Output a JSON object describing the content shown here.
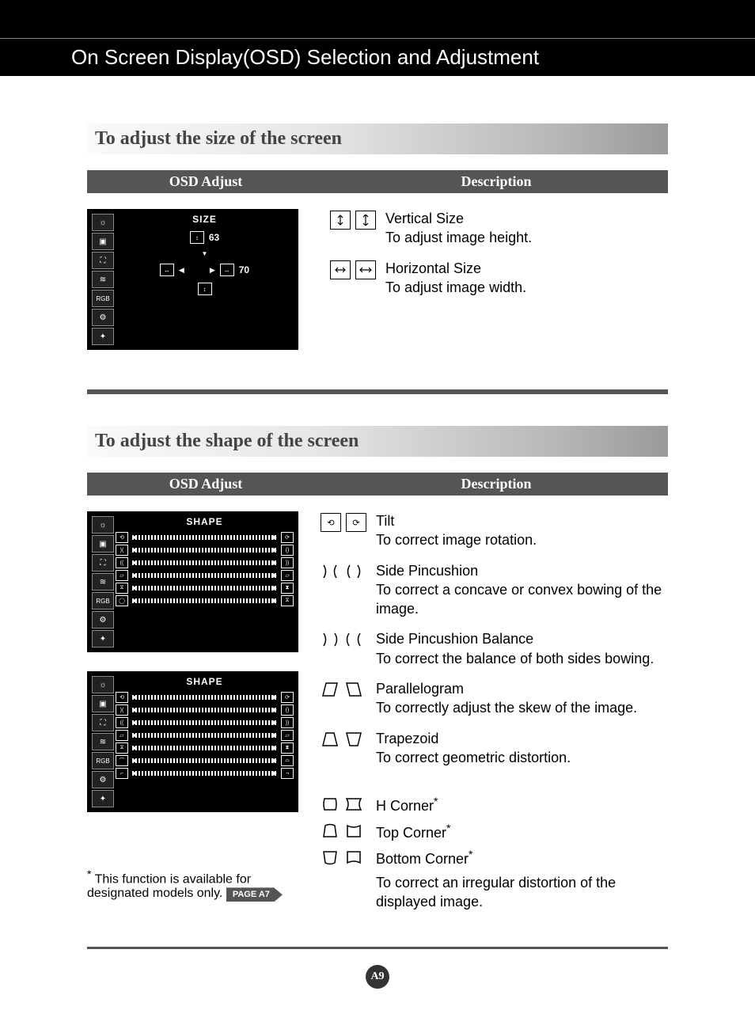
{
  "header": {
    "title": "On Screen Display(OSD) Selection and Adjustment"
  },
  "section_size": {
    "heading": "To adjust the size of the screen",
    "col_left": "OSD Adjust",
    "col_right": "Description",
    "osd": {
      "title": "SIZE",
      "v_value": "63",
      "h_value": "70"
    },
    "desc": {
      "v_title": "Vertical Size",
      "v_body": "To adjust image height.",
      "h_title": "Horizontal Size",
      "h_body": "To adjust image width."
    }
  },
  "section_shape": {
    "heading": "To adjust the shape of the screen",
    "col_left": "OSD Adjust",
    "col_right": "Description",
    "osd1_title": "SHAPE",
    "osd2_title": "SHAPE",
    "items": {
      "tilt_title": "Tilt",
      "tilt_body": "To correct image rotation.",
      "pin_title": "Side Pincushion",
      "pin_body": "To correct a concave or convex bowing of the image.",
      "pinbal_title": "Side Pincushion Balance",
      "pinbal_body": "To correct the balance of both sides bowing.",
      "para_title": "Parallelogram",
      "para_body": "To correctly adjust the skew of the image.",
      "trap_title": "Trapezoid",
      "trap_body": "To correct geometric distortion.",
      "hcorner_title": "H Corner",
      "topcorner_title": "Top Corner",
      "bottomcorner_title": "Bottom Corner",
      "corner_body": "To correct an irregular distortion of the displayed image."
    }
  },
  "footnote": {
    "text_before": "This function is available for designated models only.",
    "page_ref": "PAGE A7"
  },
  "page_number": "A9"
}
